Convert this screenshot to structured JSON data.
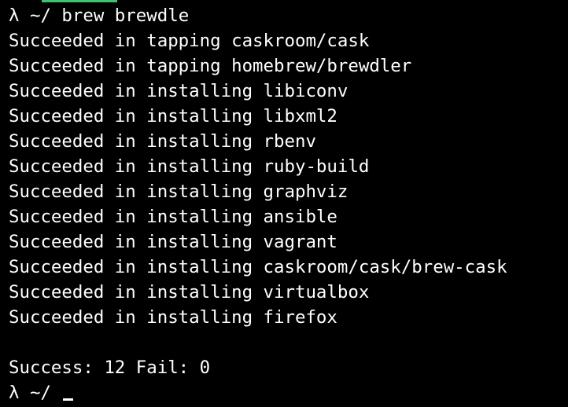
{
  "colors": {
    "background": "#000000",
    "text": "#ffffff",
    "active_tab_indicator": "#3ec46d"
  },
  "terminal": {
    "command_prompt": "λ ~/",
    "command": "brew brewdle",
    "output_lines": [
      "Succeeded in tapping caskroom/cask",
      "Succeeded in tapping homebrew/brewdler",
      "Succeeded in installing libiconv",
      "Succeeded in installing libxml2",
      "Succeeded in installing rbenv",
      "Succeeded in installing ruby-build",
      "Succeeded in installing graphviz",
      "Succeeded in installing ansible",
      "Succeeded in installing vagrant",
      "Succeeded in installing caskroom/cask/brew-cask",
      "Succeeded in installing virtualbox",
      "Succeeded in installing firefox"
    ],
    "summary": "Success: 12 Fail: 0",
    "final_prompt": "λ ~/"
  }
}
